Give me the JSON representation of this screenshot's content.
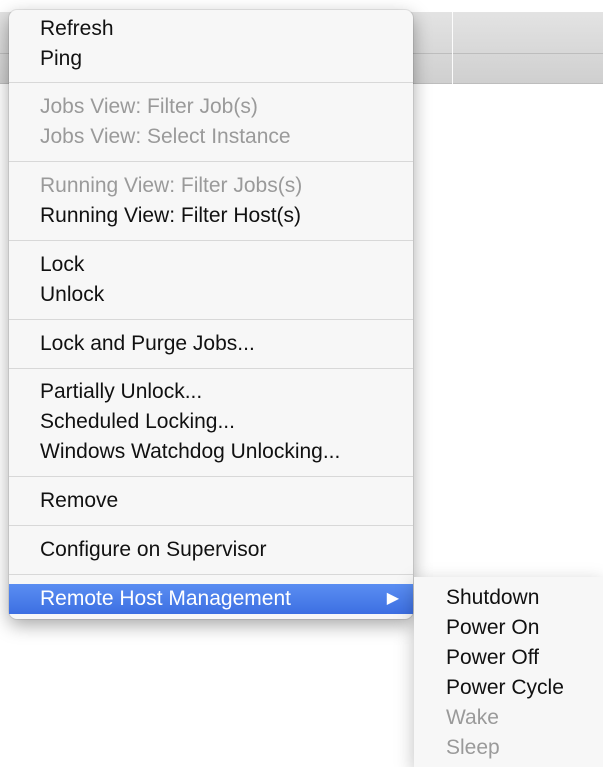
{
  "menu": {
    "items": [
      {
        "label": "Refresh",
        "enabled": true
      },
      {
        "label": "Ping",
        "enabled": true
      },
      {
        "label": "Jobs View: Filter Job(s)",
        "enabled": false
      },
      {
        "label": "Jobs View: Select Instance",
        "enabled": false
      },
      {
        "label": "Running View: Filter Jobs(s)",
        "enabled": false
      },
      {
        "label": "Running View: Filter Host(s)",
        "enabled": true
      },
      {
        "label": "Lock",
        "enabled": true
      },
      {
        "label": "Unlock",
        "enabled": true
      },
      {
        "label": "Lock and Purge Jobs...",
        "enabled": true
      },
      {
        "label": "Partially Unlock...",
        "enabled": true
      },
      {
        "label": "Scheduled Locking...",
        "enabled": true
      },
      {
        "label": "Windows Watchdog Unlocking...",
        "enabled": true
      },
      {
        "label": "Remove",
        "enabled": true
      },
      {
        "label": "Configure on Supervisor",
        "enabled": true
      },
      {
        "label": "Remote Host Management",
        "enabled": true,
        "highlighted": true,
        "has_submenu": true
      }
    ],
    "submenu_arrow": "▶"
  },
  "submenu": {
    "items": [
      {
        "label": "Shutdown",
        "enabled": true
      },
      {
        "label": "Power On",
        "enabled": true
      },
      {
        "label": "Power Off",
        "enabled": true
      },
      {
        "label": "Power Cycle",
        "enabled": true
      },
      {
        "label": "Wake",
        "enabled": false
      },
      {
        "label": "Sleep",
        "enabled": false
      }
    ]
  },
  "colors": {
    "highlight": "#3d6fe2",
    "disabled_text": "#9a9a9a",
    "menu_bg": "#f7f7f7"
  }
}
